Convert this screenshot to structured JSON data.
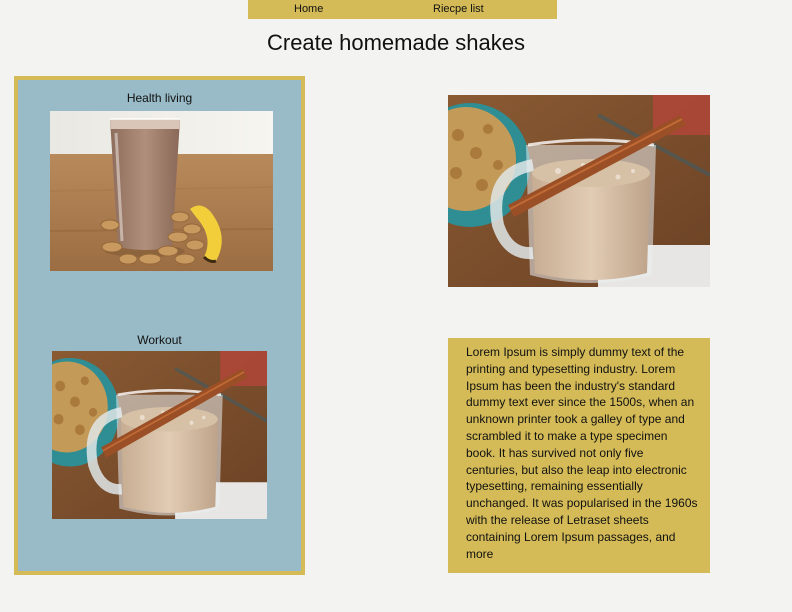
{
  "nav": {
    "items": [
      {
        "label": "Home"
      },
      {
        "label": "Riecpe list"
      }
    ]
  },
  "page": {
    "title": "Create homemade shakes"
  },
  "cards": [
    {
      "label": "Health living",
      "image": "chocolate-shake-peanuts-banana"
    },
    {
      "label": "Workout",
      "image": "cinnamon-shake-mug"
    }
  ],
  "feature": {
    "image": "cinnamon-shake-mug",
    "text": "Lorem Ipsum is simply dummy text of the printing and typesetting industry. Lorem Ipsum has been the industry's standard dummy text ever since the 1500s, when an unknown printer took a galley of type and scrambled it to make a type specimen book. It has survived not only five centuries, but also the leap into electronic typesetting, remaining essentially unchanged. It was popularised in the 1960s with the release of Letraset sheets containing Lorem Ipsum passages, and more"
  },
  "colors": {
    "background": "#f3f3f2",
    "accent": "#d4bb57",
    "panel": "#99bbc7"
  }
}
